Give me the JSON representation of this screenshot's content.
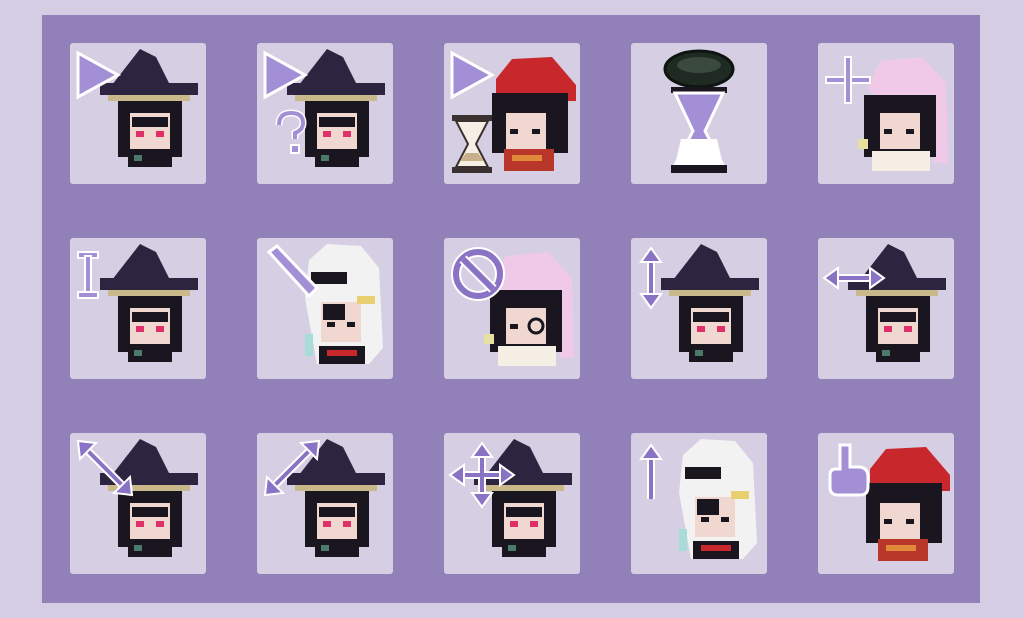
{
  "colors": {
    "page_bg": "#d4cde3",
    "panel_bg": "#9280b9",
    "tile_bg": "#d6cfe3",
    "cursor_fill": "#a38fd6",
    "cursor_outline": "#ffffff",
    "cursor_stroke": "#6b58a3",
    "witch_hat": "#2d2540",
    "hair_black": "#1a1620",
    "skin": "#f0d8d0",
    "eye_pink": "#e0306a",
    "red_hat": "#c8282c",
    "pink_hood": "#f0c8e8",
    "white_hair": "#f2f2f2",
    "dark_hat": "#1e2a22"
  },
  "cursor_tiles": [
    {
      "cursor": "arrow-pointer",
      "character": "witch"
    },
    {
      "cursor": "help-pointer",
      "character": "witch"
    },
    {
      "cursor": "working-in-background",
      "character": "red-hat-girl"
    },
    {
      "cursor": "busy-hourglass",
      "character": "none"
    },
    {
      "cursor": "precision-crosshair",
      "character": "pink-hood-girl"
    },
    {
      "cursor": "text-select-ibeam",
      "character": "witch"
    },
    {
      "cursor": "handwriting-pen",
      "character": "white-hair-girl"
    },
    {
      "cursor": "unavailable",
      "character": "pink-hood-girl"
    },
    {
      "cursor": "vertical-resize",
      "character": "witch"
    },
    {
      "cursor": "horizontal-resize",
      "character": "witch"
    },
    {
      "cursor": "diagonal-resize-1",
      "character": "witch"
    },
    {
      "cursor": "diagonal-resize-2",
      "character": "witch"
    },
    {
      "cursor": "move",
      "character": "witch"
    },
    {
      "cursor": "alternate-select",
      "character": "white-hair-girl"
    },
    {
      "cursor": "link-select-hand",
      "character": "red-hat-girl"
    }
  ]
}
